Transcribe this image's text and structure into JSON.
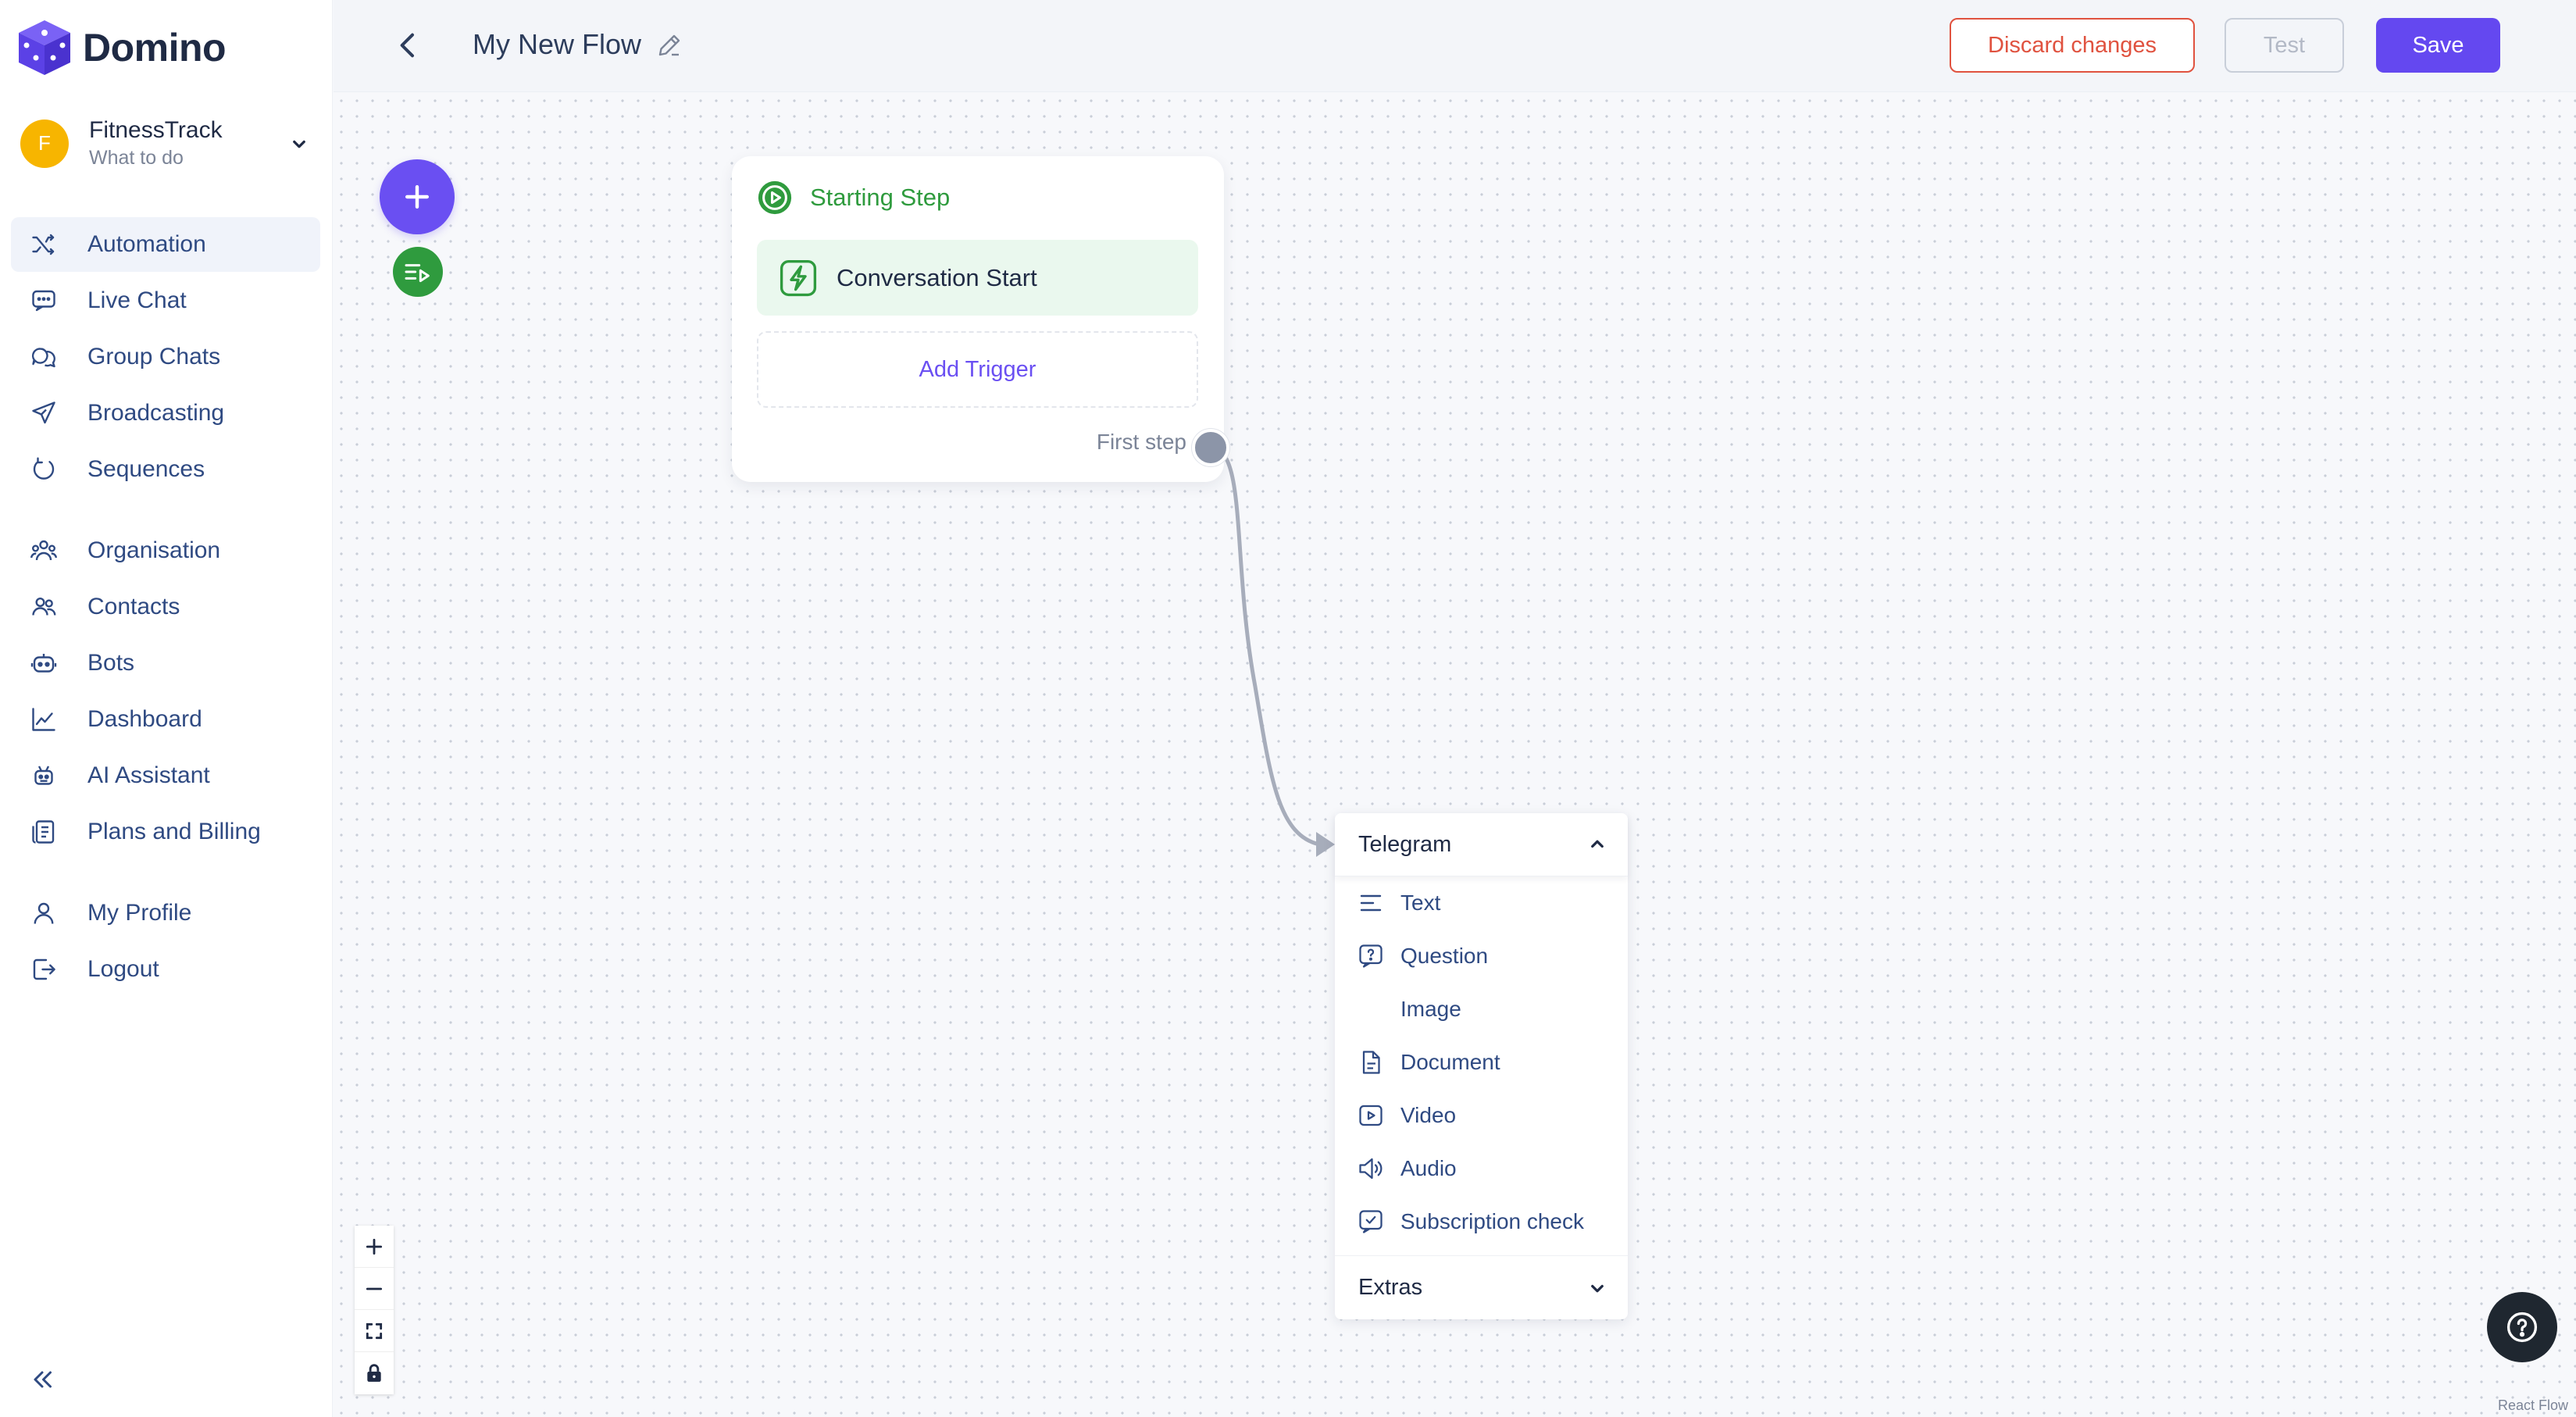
{
  "brand": {
    "name": "Domino"
  },
  "org": {
    "avatar_letter": "F",
    "name": "FitnessTrack",
    "subtitle": "What to do"
  },
  "nav": {
    "main": [
      {
        "label": "Automation",
        "icon": "shuffle-icon",
        "active": true
      },
      {
        "label": "Live Chat",
        "icon": "chat-bubble-icon"
      },
      {
        "label": "Group Chats",
        "icon": "group-chat-icon"
      },
      {
        "label": "Broadcasting",
        "icon": "send-icon"
      },
      {
        "label": "Sequences",
        "icon": "sequence-loop-icon"
      }
    ],
    "manage": [
      {
        "label": "Organisation",
        "icon": "organisation-icon"
      },
      {
        "label": "Contacts",
        "icon": "contacts-icon"
      },
      {
        "label": "Bots",
        "icon": "bot-icon"
      },
      {
        "label": "Dashboard",
        "icon": "chart-line-icon"
      },
      {
        "label": "AI Assistant",
        "icon": "ai-robot-icon"
      },
      {
        "label": "Plans and Billing",
        "icon": "billing-icon"
      }
    ],
    "account": [
      {
        "label": "My Profile",
        "icon": "user-icon"
      },
      {
        "label": "Logout",
        "icon": "logout-icon"
      }
    ]
  },
  "header": {
    "flow_title": "My New Flow",
    "discard_label": "Discard changes",
    "test_label": "Test",
    "save_label": "Save"
  },
  "start_node": {
    "title": "Starting Step",
    "trigger_label": "Conversation Start",
    "add_trigger_label": "Add Trigger",
    "first_step_label": "First step"
  },
  "step_menu": {
    "group_label": "Telegram",
    "items": [
      {
        "label": "Text",
        "icon": "text-lines-icon"
      },
      {
        "label": "Question",
        "icon": "question-bubble-icon"
      },
      {
        "label": "Image",
        "icon": "image-icon"
      },
      {
        "label": "Document",
        "icon": "document-icon"
      },
      {
        "label": "Video",
        "icon": "video-icon"
      },
      {
        "label": "Audio",
        "icon": "speaker-icon"
      },
      {
        "label": "Subscription check",
        "icon": "subscription-check-icon"
      }
    ],
    "extras_label": "Extras"
  },
  "canvas": {
    "attribution": "React Flow"
  },
  "colors": {
    "accent": "#6448f0",
    "success": "#2f9b3e",
    "danger": "#e0523f",
    "nav_text": "#2f4a82"
  }
}
